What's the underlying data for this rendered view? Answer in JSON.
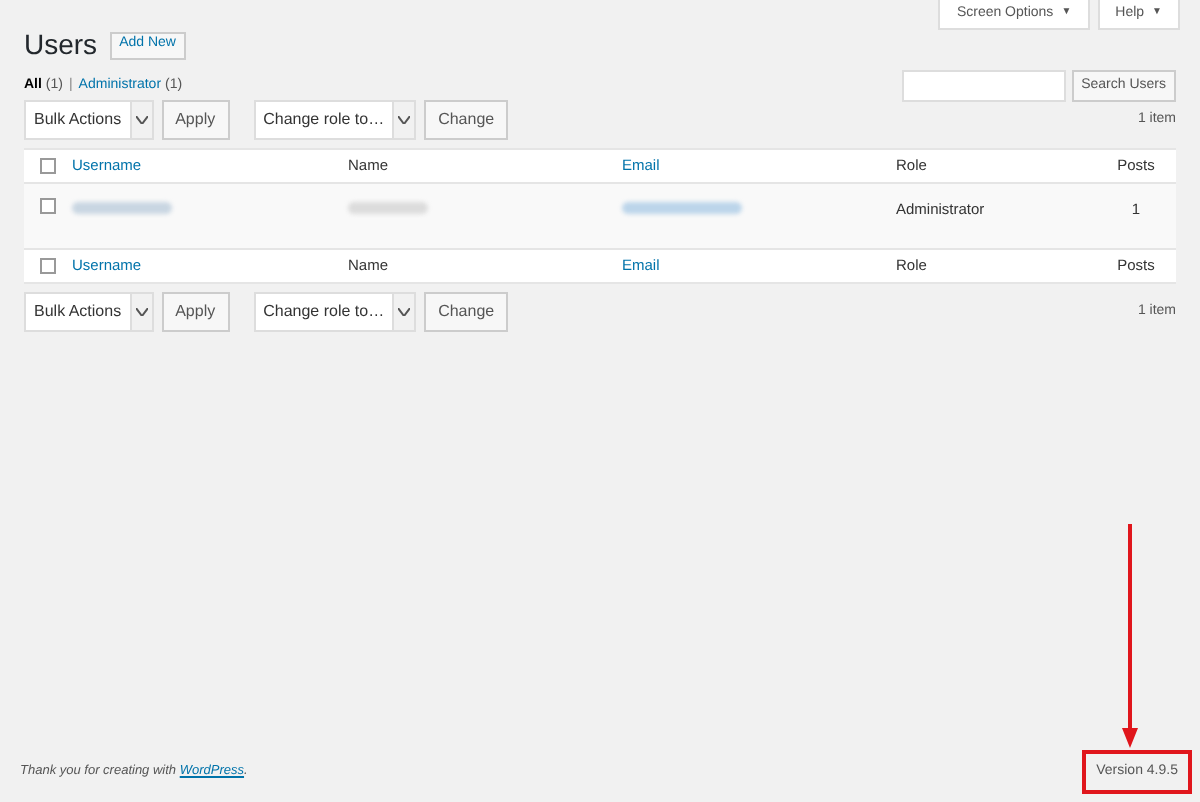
{
  "header_buttons": [
    {
      "label": "Screen Options",
      "caret": "▼"
    },
    {
      "label": "Help",
      "caret": "▼"
    }
  ],
  "title": "Users",
  "add_new": "Add New",
  "filters": [
    {
      "label": "All",
      "count": "(1)",
      "selected": true
    },
    {
      "label": "Administrator",
      "count": "(1)",
      "selected": false
    }
  ],
  "search": {
    "button": "Search Users"
  },
  "toolbars": [
    {
      "bulk": "Bulk Actions",
      "apply": "Apply",
      "role": "Change role to…",
      "change": "Change",
      "count": "1 item"
    },
    {
      "bulk": "Bulk Actions",
      "apply": "Apply",
      "role": "Change role to…",
      "change": "Change",
      "count": "1 item"
    }
  ],
  "filter_separator": "|",
  "table": {
    "select_all_checked": false,
    "columns": [
      {
        "label": "Username",
        "sortable": true
      },
      {
        "label": "Name",
        "sortable": false
      },
      {
        "label": "Email",
        "sortable": true
      },
      {
        "label": "Role",
        "sortable": false
      },
      {
        "label": "Posts",
        "sortable": false
      }
    ],
    "footer_select_all_checked": false,
    "footer_columns": [
      {
        "label": "Username",
        "sortable": true
      },
      {
        "label": "Name",
        "sortable": false
      },
      {
        "label": "Email",
        "sortable": true
      },
      {
        "label": "Role",
        "sortable": false
      },
      {
        "label": "Posts",
        "sortable": false
      }
    ],
    "rows": [
      {
        "checked": false,
        "role": "Administrator",
        "posts": "1"
      }
    ]
  },
  "footer": {
    "text": "Thank you for creating with ",
    "link": "WordPress",
    "link_end": ".",
    "version": "Version 4.9.5",
    "highlighted": true
  }
}
